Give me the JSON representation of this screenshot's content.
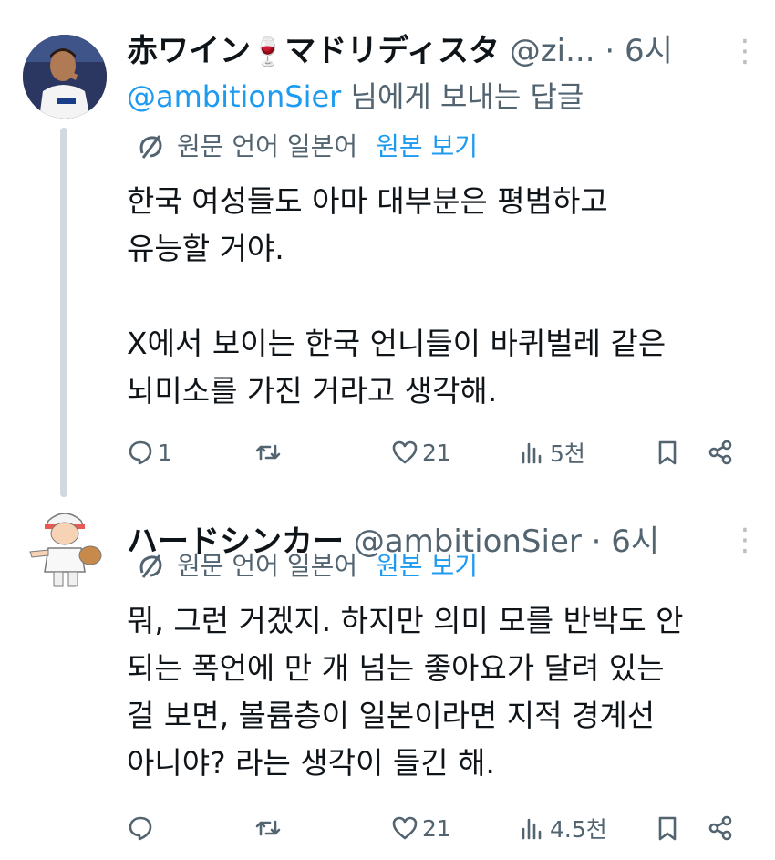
{
  "tweets": [
    {
      "display_name": "赤ワイン",
      "display_name_suffix": "マドリディスタ",
      "emoji": "🍷",
      "handle": "@zi...",
      "separator": "·",
      "time": "6시",
      "reply_to": {
        "mention": "@ambitionSier",
        "suffix": " 님에게 보내는 답글"
      },
      "translate": {
        "label": "원문 언어 일본어",
        "action": "원본 보기"
      },
      "body": "한국 여성들도 아마 대부분은 평범하고\n유능할 거야.\n\nX에서 보이는 한국 언니들이 바퀴벌레 같은\n뇌미소를 가진 거라고 생각해.",
      "stats": {
        "replies": "1",
        "retweets": "",
        "likes": "21",
        "views": "5천"
      }
    },
    {
      "display_name": "ハードシンカー",
      "handle": "@ambitionSier",
      "separator": "·",
      "time": "6시",
      "translate": {
        "label": "원문 언어 일본어",
        "action": "원본 보기"
      },
      "body": "뭐, 그런 거겠지. 하지만 의미 모를 반박도 안\n되는 폭언에 만 개 넘는 좋아요가 달려 있는\n걸 보면, 볼륨층이 일본이라면 지적 경계선\n아니야? 라는 생각이 들긴 해.",
      "stats": {
        "replies": "",
        "retweets": "",
        "likes": "21",
        "views": "4.5천"
      }
    }
  ],
  "icons": {
    "more": "more-vertical-icon",
    "translate": "translate-icon",
    "reply": "reply-icon",
    "retweet": "retweet-icon",
    "like": "heart-icon",
    "views": "views-chart-icon",
    "bookmark": "bookmark-icon",
    "share": "share-icon"
  },
  "colors": {
    "link": "#1d9bf0",
    "secondary_text": "#536471",
    "thread_line": "#cfd9de"
  }
}
